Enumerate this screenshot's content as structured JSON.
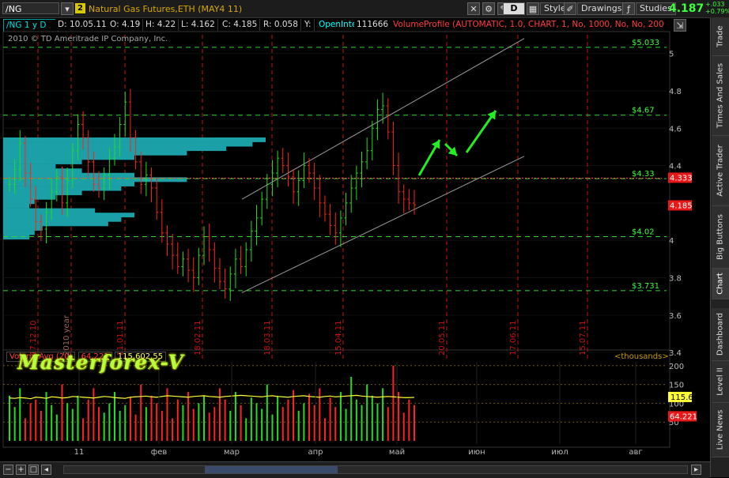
{
  "toolbar": {
    "symbol": "/NG",
    "link_badge": "2",
    "description": "Natural Gas Futures,ETH (MAY4 11)",
    "period_button": "D",
    "style_label": "Style",
    "drawings_label": "Drawings",
    "studies_label": "Studies",
    "last_price": "4.187",
    "change_abs": "+.033",
    "change_pct": "+0.79%"
  },
  "infobar": {
    "symbol_period": "/NG 1 y D",
    "date": "D: 10.05.11",
    "open": "O: 4.19",
    "high": "H: 4.22",
    "low": "L: 4.162",
    "close": "C: 4.185",
    "range": "R: 0.058",
    "y": "Y:",
    "oi_label": "OpenInterest",
    "oi_value": "111666",
    "volume_profile": "VolumeProfile (AUTOMATIC, 1.0, CHART, 1, No, 1000, No, No, 200, ..."
  },
  "copyright": "2010 © TD Ameritrade IP Company, Inc.",
  "watermark": "Masterforex-V",
  "volume_pane": {
    "study_label": "VolumeAvg (20)",
    "avg_value": "64,221",
    "total_value": "115,602.55",
    "units_label": "<thousands>",
    "y_ticks": [
      "200",
      "150",
      "100",
      "50"
    ],
    "avg_badge": "115.6",
    "vol_badge": "64.221",
    "colors": {
      "up": "#22dd22",
      "down": "#ff2222",
      "avg_line": "#ffff33"
    }
  },
  "right_tabs": [
    "Trade",
    "Times And Sales",
    "Active Trader",
    "Big Buttons",
    "Chart",
    "Dashboard",
    "Level II",
    "Live News"
  ],
  "chart_data": {
    "type": "candlestick",
    "price_axis": {
      "ylim": [
        3.35,
        5.1
      ],
      "ticks": [
        "5",
        "4.8",
        "4.6",
        "4.4",
        "4.2",
        "4",
        "3.8",
        "3.6",
        "3.4"
      ]
    },
    "month_labels": [
      "11",
      "фев",
      "мар",
      "апр",
      "май",
      "июн",
      "июл",
      "авг"
    ],
    "date_markers": [
      "17.12.10",
      "2010 year",
      "21.01.11",
      "18.02.11",
      "18.03.11",
      "15.04.11",
      "20.05.11",
      "17.06.11",
      "15.07.11"
    ],
    "horizontal_levels": [
      {
        "label": "$5.033",
        "value": 5.033
      },
      {
        "label": "$4.67",
        "value": 4.67
      },
      {
        "label": "$4.33",
        "value": 4.33
      },
      {
        "label": "$4.02",
        "value": 4.02
      },
      {
        "label": "$3.731",
        "value": 3.731
      }
    ],
    "price_badges": [
      {
        "label": "4.333",
        "value": 4.333
      },
      {
        "label": "4.185",
        "value": 4.185
      }
    ],
    "channel": {
      "lower": {
        "from": [
          "26.02.11",
          3.72
        ],
        "to": [
          "07.07.11",
          4.45
        ]
      },
      "upper": {
        "from": [
          "26.02.11",
          4.22
        ],
        "to": [
          "07.07.11",
          5.08
        ]
      }
    },
    "closes": [
      4.3,
      4.38,
      4.52,
      4.36,
      4.22,
      4.1,
      4.06,
      4.15,
      4.26,
      4.34,
      4.2,
      4.32,
      4.48,
      4.62,
      4.55,
      4.42,
      4.3,
      4.28,
      4.35,
      4.44,
      4.5,
      4.62,
      4.74,
      4.55,
      4.42,
      4.3,
      4.35,
      4.28,
      4.15,
      4.04,
      3.98,
      3.92,
      3.86,
      3.9,
      3.84,
      3.8,
      3.92,
      4.02,
      3.95,
      3.85,
      3.78,
      3.74,
      3.82,
      3.9,
      3.86,
      3.95,
      4.05,
      4.12,
      4.22,
      4.3,
      4.36,
      4.44,
      4.4,
      4.34,
      4.26,
      4.32,
      4.4,
      4.36,
      4.28,
      4.2,
      4.14,
      4.08,
      4.04,
      4.12,
      4.2,
      4.28,
      4.36,
      4.42,
      4.48,
      4.6,
      4.7,
      4.72,
      4.58,
      4.4,
      4.26,
      4.22,
      4.2,
      4.19
    ],
    "volume_profile": [
      1.0,
      0.95,
      0.85,
      0.7,
      0.5,
      0.3,
      0.2,
      0.3,
      0.5,
      0.7,
      0.5,
      0.45,
      0.3,
      0.2,
      0.12,
      0.1,
      0.35,
      0.5,
      0.45,
      0.4,
      0.15,
      0.12,
      0.1
    ],
    "volume_values": [
      120,
      90,
      140,
      60,
      100,
      110,
      80,
      130,
      95,
      70,
      150,
      100,
      85,
      120,
      60,
      110,
      140,
      90,
      75,
      100,
      130,
      80,
      95,
      115,
      70,
      150,
      90,
      120,
      100,
      80,
      140,
      60,
      110,
      95,
      130,
      85,
      100,
      120,
      75,
      90,
      140,
      110,
      80,
      130,
      95,
      60,
      115,
      100,
      85,
      150,
      70,
      120,
      90,
      110,
      135,
      80,
      100,
      125,
      95,
      140,
      60,
      115,
      90,
      130,
      85,
      170,
      110,
      95,
      150,
      120,
      100,
      140,
      90,
      200,
      130,
      75,
      110,
      95
    ],
    "volume_avg": [
      114,
      113,
      115,
      114,
      112,
      116,
      115,
      113,
      117,
      116,
      114,
      115,
      118,
      117,
      116,
      115,
      114,
      116,
      118,
      117,
      115,
      114,
      113,
      116,
      117,
      118,
      119,
      117,
      116,
      118,
      120,
      119,
      118,
      117,
      116,
      118,
      119,
      120,
      118,
      117,
      116,
      118,
      119,
      120,
      121,
      120,
      119,
      118,
      117,
      119,
      120,
      118,
      117,
      116,
      118,
      119,
      120,
      118,
      117,
      116,
      118,
      119,
      117,
      118,
      119,
      120,
      121,
      119,
      118,
      117,
      116,
      117,
      118,
      117,
      116,
      115,
      115,
      115.6
    ],
    "volume_ylim": [
      0,
      210
    ],
    "arrows": [
      "up",
      "down",
      "up"
    ]
  }
}
